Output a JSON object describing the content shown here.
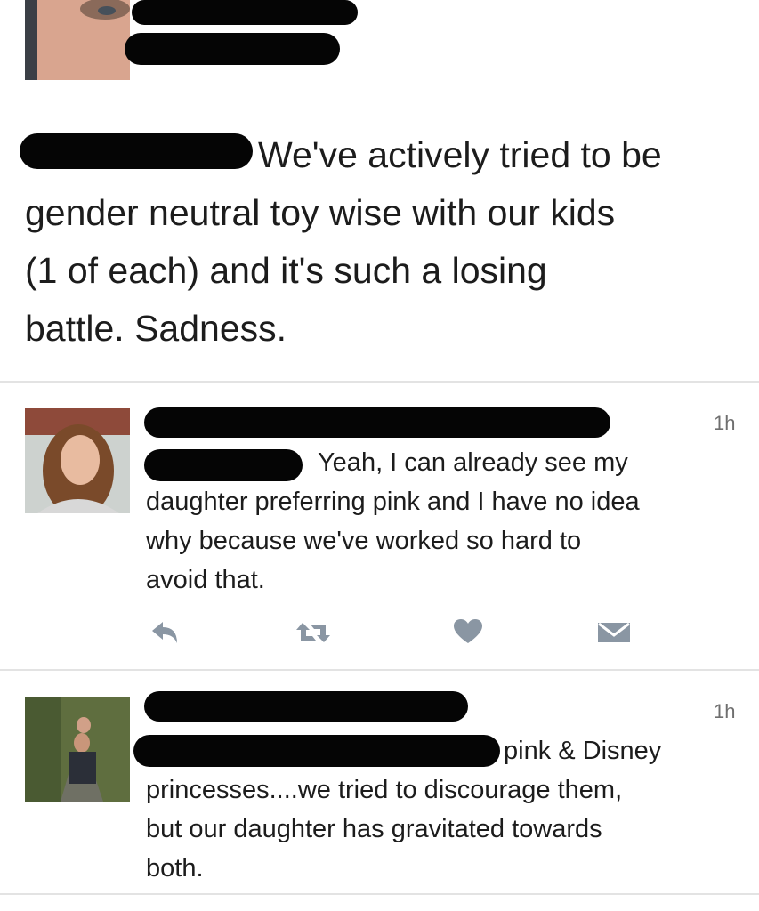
{
  "main_tweet": {
    "text": "We've actively tried to be\ngender neutral toy wise with our kids\n(1 of each) and it's such a losing\nbattle. Sadness."
  },
  "replies": [
    {
      "timestamp": "1h",
      "text": "Yeah, I can already see my\ndaughter preferring pink and I have no idea\nwhy because we've worked so hard to\navoid that."
    },
    {
      "timestamp": "1h",
      "text": "pink & Disney\nprincesses....we tried to discourage them,\nbut our daughter has gravitated towards\nboth."
    }
  ],
  "icons": [
    "reply-icon",
    "retweet-icon",
    "like-icon",
    "direct-message-icon"
  ],
  "colors": {
    "icon": "#8a96a3",
    "divider": "#e3e3e3",
    "redaction": "#050505"
  }
}
